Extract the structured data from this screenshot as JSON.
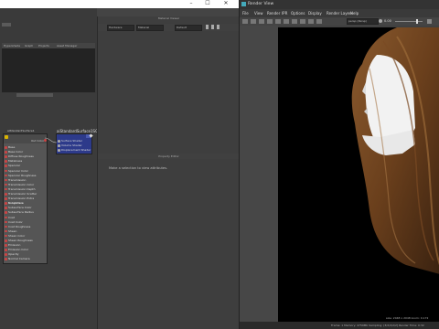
{
  "titlebar": {
    "min": "–",
    "max": "☐",
    "close": "✕"
  },
  "hypershade": {
    "tabs": [
      "Hypershade",
      "Graph",
      "Projects",
      "Asset Manager"
    ],
    "node_left": {
      "title": "aiStandardSurface1",
      "out_label": "Out Color",
      "attributes": [
        "Base",
        "Base Color",
        "Diffuse Roughness",
        "Metalness",
        "Specular",
        "Specular Color",
        "Specular Roughness",
        "Transmission",
        "Transmission Color",
        "Transmission Depth",
        "Transmission Scatter",
        "Transmission Extra Roughness",
        "Subsurface",
        "Subsurface Color",
        "Subsurface Radius",
        "Coat",
        "Coat Color",
        "Coat Roughness",
        "Sheen",
        "Sheen Color",
        "Sheen Roughness",
        "Emission",
        "Emission Color",
        "Opacity",
        "Normal Camera"
      ]
    },
    "node_right": {
      "title": "aiStandardSurface1SG",
      "attributes": [
        "Surface Shader",
        "Volume Shader",
        "Displacement Shader"
      ]
    }
  },
  "middle": {
    "title": "Material Viewer",
    "select1": "Hardware",
    "select2": "Material",
    "select3": "Default",
    "property_title": "Property Editor",
    "empty_hint": "Make a selection to view attributes."
  },
  "render": {
    "title": "Render View",
    "menu": [
      "File",
      "View",
      "Render",
      "IPR",
      "Options",
      "Display",
      "Render Layers",
      "Help"
    ],
    "camera_select": "persp (Persp)",
    "exposure": "0.00",
    "status_size": "size: 2048 x 2048  zoom: 0.172",
    "status_frame": "Frame: 1   Memory: 4759Mb   Sampling: [3/2/2/2/2]   Render Time: 0:32"
  },
  "colors": {
    "accent": "#2d3a8a",
    "render_bg": "#000000"
  }
}
